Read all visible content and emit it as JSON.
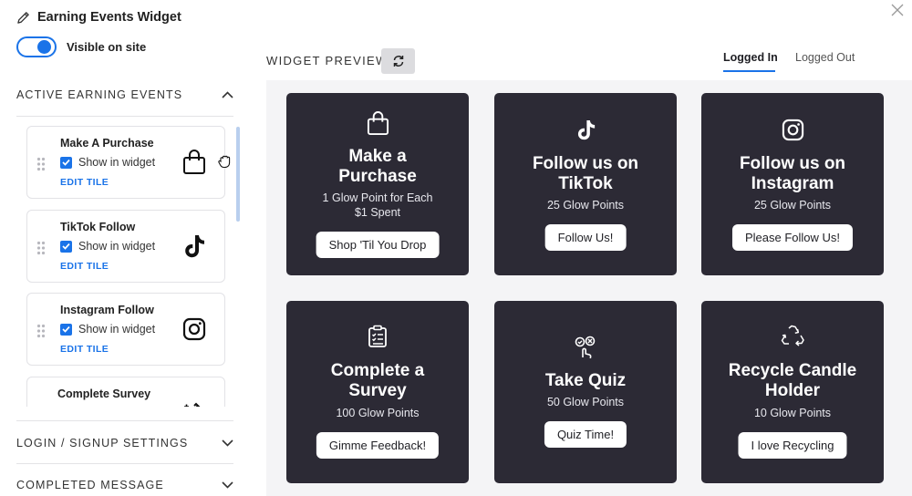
{
  "widget": {
    "title": "Earning Events Widget",
    "visible_label": "Visible on site",
    "visible": true
  },
  "sections": {
    "active": "ACTIVE EARNING EVENTS",
    "login": "LOGIN / SIGNUP SETTINGS",
    "completed": "COMPLETED MESSAGE"
  },
  "tiles": [
    {
      "name": "Make A Purchase",
      "show_label": "Show in widget",
      "edit_label": "EDIT TILE",
      "icon": "shopping-bag-icon"
    },
    {
      "name": "TikTok Follow",
      "show_label": "Show in widget",
      "edit_label": "EDIT TILE",
      "icon": "tiktok-icon"
    },
    {
      "name": "Instagram Follow",
      "show_label": "Show in widget",
      "edit_label": "EDIT TILE",
      "icon": "instagram-icon"
    },
    {
      "name": "Complete Survey",
      "icon": "magic-wand-icon"
    }
  ],
  "preview": {
    "label": "WIDGET PREVIEW",
    "tabs": [
      "Logged In",
      "Logged Out"
    ],
    "active_tab": "Logged In",
    "cards": [
      {
        "title_1": "Make a",
        "title_2": "Purchase",
        "sub_1": "1 Glow Point for Each",
        "sub_2": "$1 Spent",
        "button": "Shop 'Til You Drop",
        "icon": "shopping-bag-icon"
      },
      {
        "title_1": "Follow us on",
        "title_2": "TikTok",
        "sub_1": "25 Glow Points",
        "button": "Follow Us!",
        "icon": "tiktok-icon"
      },
      {
        "title_1": "Follow us on",
        "title_2": "Instagram",
        "sub_1": "25 Glow Points",
        "button": "Please Follow Us!",
        "icon": "instagram-icon"
      },
      {
        "title_1": "Complete a",
        "title_2": "Survey",
        "sub_1": "100 Glow Points",
        "button": "Gimme Feedback!",
        "icon": "clipboard-icon"
      },
      {
        "title_1": "Take Quiz",
        "sub_1": "50 Glow Points",
        "button": "Quiz Time!",
        "icon": "quiz-icon"
      },
      {
        "title_1": "Recycle Candle",
        "title_2": "Holder",
        "sub_1": "10 Glow Points",
        "button": "I love Recycling",
        "icon": "recycle-icon"
      }
    ]
  },
  "colors": {
    "accent": "#1a73e8",
    "card_bg": "#2c2a35",
    "stage_bg": "#f4f4f6"
  }
}
